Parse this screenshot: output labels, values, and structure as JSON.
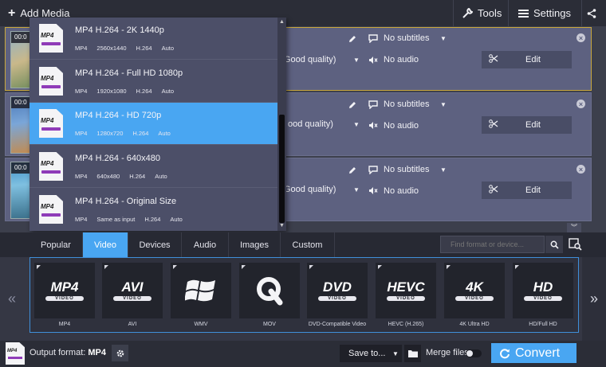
{
  "topbar": {
    "add_media_label": "Add Media",
    "tools_label": "Tools",
    "settings_label": "Settings"
  },
  "files": [
    {
      "time": "00:0",
      "quality": "Good quality)",
      "subtitles": "No subtitles",
      "audio": "No audio",
      "edit_label": "Edit",
      "selected": true
    },
    {
      "time": "00:0",
      "quality": "ood quality)",
      "subtitles": "No subtitles",
      "audio": "No audio",
      "edit_label": "Edit",
      "selected": false
    },
    {
      "time": "00:0",
      "quality": "Good quality)",
      "subtitles": "No subtitles",
      "audio": "No audio",
      "edit_label": "Edit",
      "selected": false
    }
  ],
  "dropdown": {
    "items": [
      {
        "icon_text": "MP4",
        "title": "MP4 H.264 - 2K 1440p",
        "meta": [
          "MP4",
          "2560x1440",
          "H.264",
          "Auto"
        ]
      },
      {
        "icon_text": "MP4",
        "title": "MP4 H.264 - Full HD 1080p",
        "meta": [
          "MP4",
          "1920x1080",
          "H.264",
          "Auto"
        ]
      },
      {
        "icon_text": "MP4",
        "title": "MP4 H.264 - HD 720p",
        "meta": [
          "MP4",
          "1280x720",
          "H.264",
          "Auto"
        ],
        "active": true
      },
      {
        "icon_text": "MP4",
        "title": "MP4 H.264 - 640x480",
        "meta": [
          "MP4",
          "640x480",
          "H.264",
          "Auto"
        ]
      },
      {
        "icon_text": "MP4",
        "title": "MP4 H.264 - Original Size",
        "meta": [
          "MP4",
          "Same as input",
          "H.264",
          "Auto"
        ]
      }
    ]
  },
  "tabs": [
    "Popular",
    "Video",
    "Devices",
    "Audio",
    "Images",
    "Custom"
  ],
  "active_tab": "Video",
  "search": {
    "placeholder": "Find format or device..."
  },
  "formats": [
    {
      "logo": "MP4",
      "sub": "VIDEO",
      "label": "MP4"
    },
    {
      "logo": "AVI",
      "sub": "VIDEO",
      "label": "AVI"
    },
    {
      "logo": "",
      "sub": "",
      "label": "WMV"
    },
    {
      "logo": "Q",
      "sub": "",
      "label": "MOV"
    },
    {
      "logo": "DVD",
      "sub": "VIDEO",
      "label": "DVD-Compatible Video"
    },
    {
      "logo": "HEVC",
      "sub": "VIDEO",
      "label": "HEVC (H.265)"
    },
    {
      "logo": "4K",
      "sub": "VIDEO",
      "label": "4K Ultra HD"
    },
    {
      "logo": "HD",
      "sub": "VIDEO",
      "label": "HD/Full HD"
    }
  ],
  "bottombar": {
    "output_label": "Output format:",
    "output_value": "MP4",
    "output_icon_text": "MP4",
    "save_to_label": "Save to...",
    "merge_label": "Merge files",
    "convert_label": "Convert"
  },
  "colors": {
    "accent": "#49a6f2",
    "selection_border": "#c9a83c",
    "row_bg": "#5d6180",
    "panel_bg": "#2b2d37"
  }
}
